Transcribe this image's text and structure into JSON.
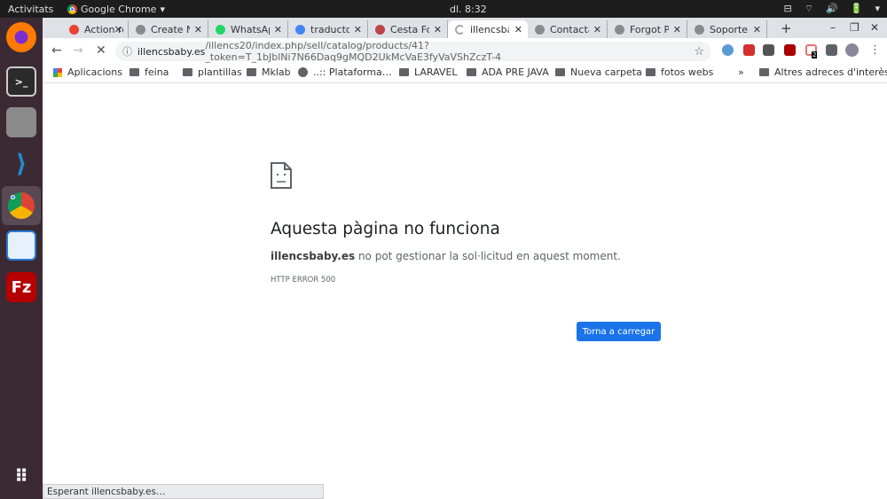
{
  "topbar": {
    "activities": "Activitats",
    "app": "Google Chrome",
    "app_arrow": "▾",
    "clock": "dl. 8:32",
    "tray": [
      "⊟",
      "⌔",
      "🔊",
      "🔋",
      "▾"
    ]
  },
  "tabs": [
    {
      "title": "Action re",
      "color": "#ea4335"
    },
    {
      "title": "Create N",
      "color": "#8a8a8a"
    },
    {
      "title": "WhatsAp",
      "color": "#25d366"
    },
    {
      "title": "traducto",
      "color": "#4285f4"
    },
    {
      "title": "Cesta Fo",
      "color": "#b44"
    },
    {
      "title": "illencsba",
      "color": "#ccc",
      "active": true
    },
    {
      "title": "Contacta",
      "color": "#8a8a8a"
    },
    {
      "title": "Forgot P",
      "color": "#8a8a8a"
    },
    {
      "title": "Soporte",
      "color": "#8a8a8a"
    }
  ],
  "tab_close": "✕",
  "new_tab": "+",
  "window": {
    "minimize": "–",
    "maximize": "❐",
    "close": "✕"
  },
  "toolbar": {
    "back": "←",
    "forward": "→",
    "stop": "✕",
    "info": "ⓘ",
    "url_host": "illencsbaby.es",
    "url_path": "/illencs20/index.php/sell/catalog/products/41?_token=T_1bJblNi7N66Daq9gMQD2UkMcVaE3fyVaVShZczT-4",
    "star": "☆",
    "menu": "⋮",
    "ext_badge": "2"
  },
  "bookmarks": {
    "items": [
      "Aplicacions",
      "feina",
      "plantillas",
      "Mklab",
      "..:: Plataforma…",
      "LARAVEL",
      "ADA PRE JAVA",
      "Nueva carpeta",
      "fotos webs"
    ],
    "more": "»",
    "other": "Altres adreces d'interès"
  },
  "error": {
    "title": "Aquesta pàgina no funciona",
    "host": "illencsbaby.es",
    "message": " no pot gestionar la sol·licitud en aquest moment.",
    "code": "HTTP ERROR 500",
    "reload": "Torna a carregar"
  },
  "status": "Esperant illencsbaby.es…",
  "accent": "#1a73e8"
}
